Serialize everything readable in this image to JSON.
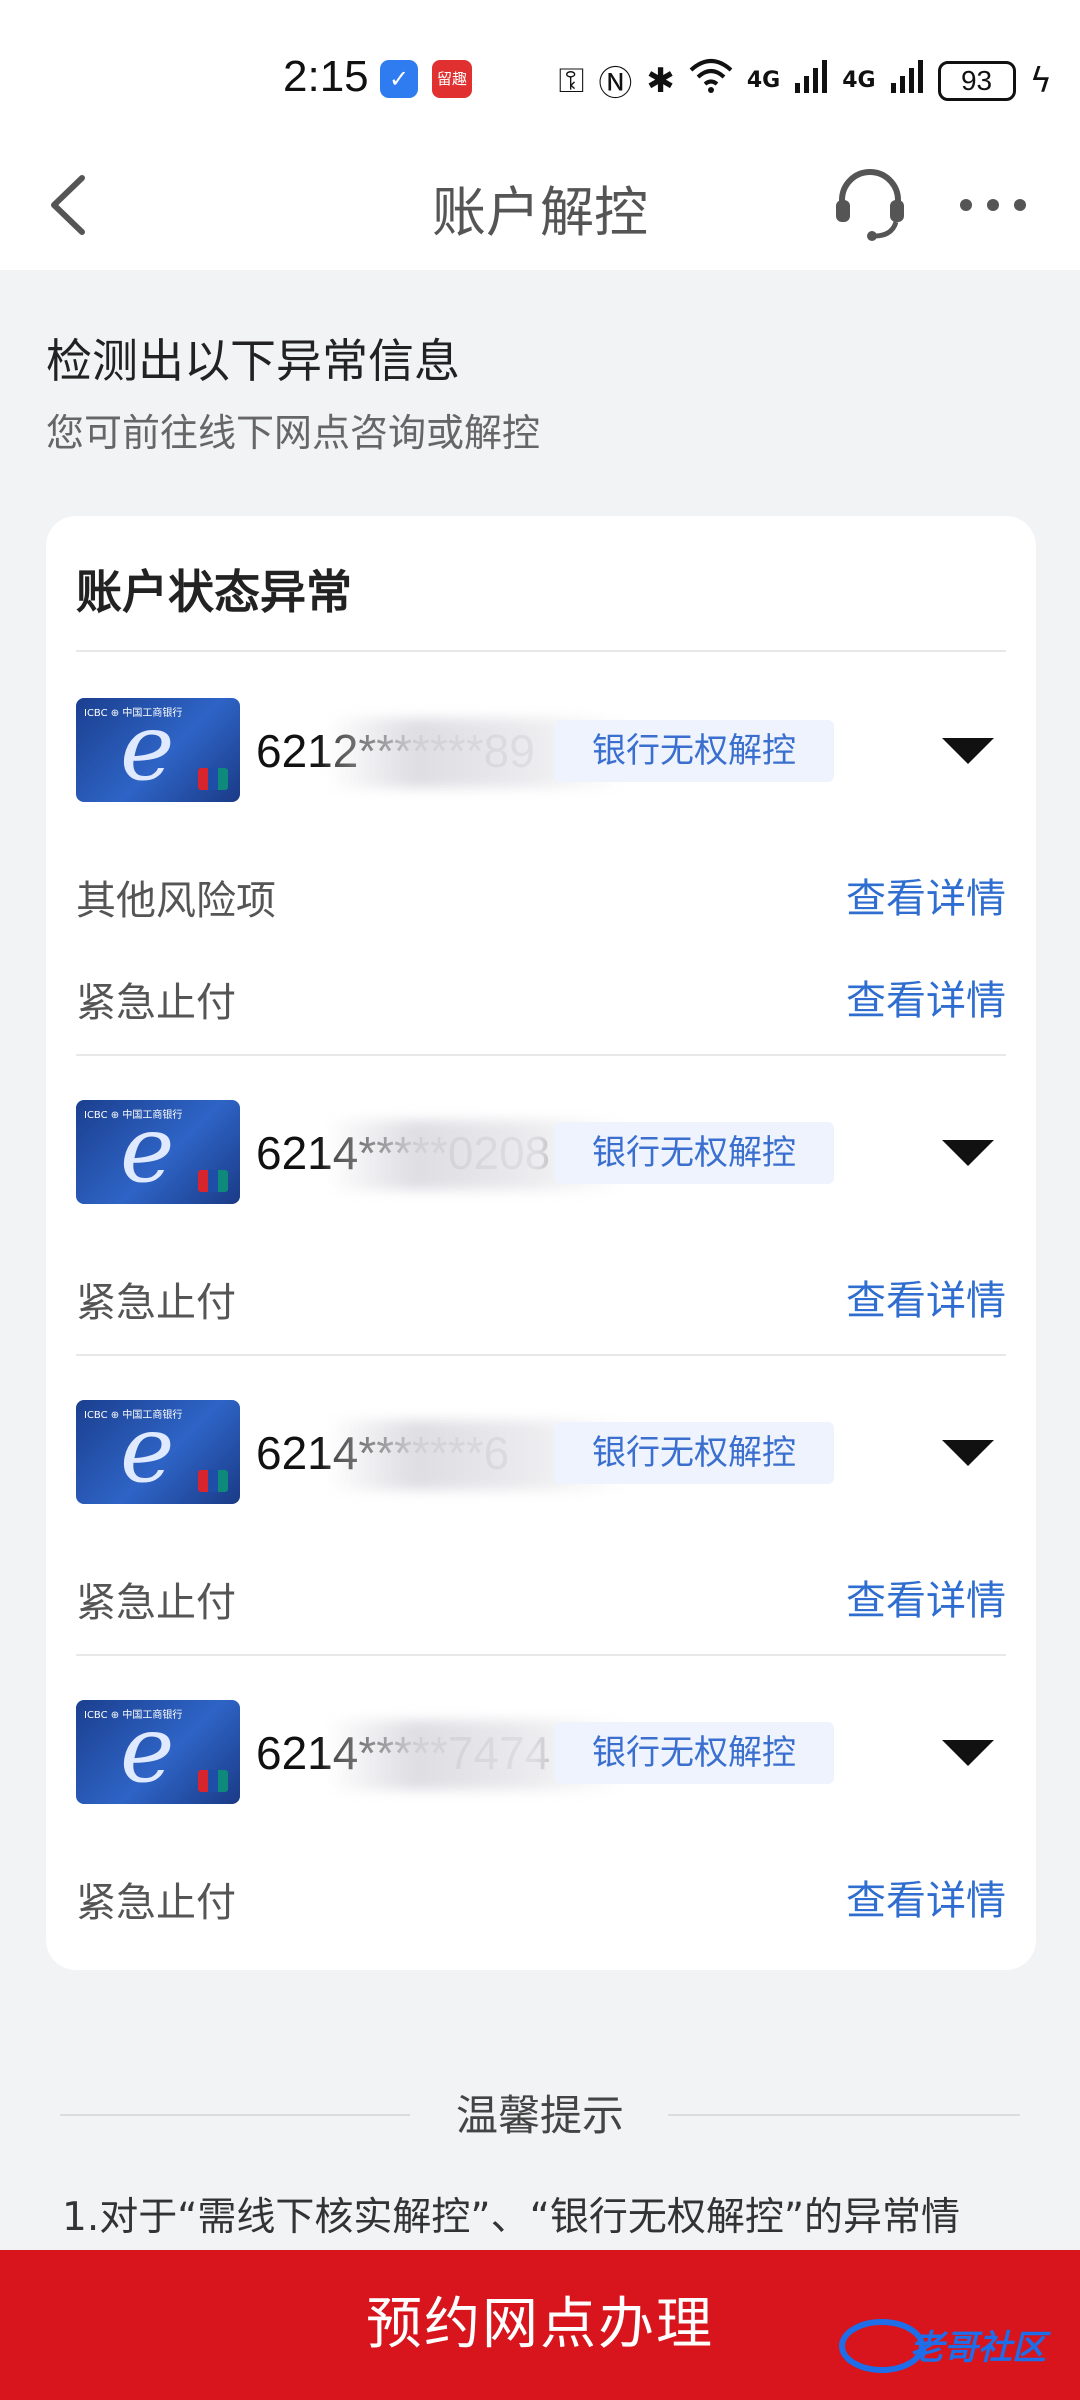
{
  "status_bar": {
    "time": "2:15",
    "app1_glyph": "✓",
    "app2_glyph": "留趣",
    "net1": "4G",
    "net2": "4G",
    "battery": "93"
  },
  "nav": {
    "title": "账户解控"
  },
  "header": {
    "title": "检测出以下异常信息",
    "subtitle": "您可前往线下网点咨询或解控"
  },
  "card": {
    "title": "账户状态异常",
    "accounts": [
      {
        "number": "6212*******89",
        "badge": "银行无权解控",
        "items": [
          {
            "label": "其他风险项",
            "link": "查看详情"
          },
          {
            "label": "紧急止付",
            "link": "查看详情"
          }
        ]
      },
      {
        "number": "6214*****0208",
        "badge": "银行无权解控",
        "items": [
          {
            "label": "紧急止付",
            "link": "查看详情"
          }
        ]
      },
      {
        "number": "6214*******6",
        "badge": "银行无权解控",
        "items": [
          {
            "label": "紧急止付",
            "link": "查看详情"
          }
        ]
      },
      {
        "number": "6214*****7474",
        "badge": "银行无权解控",
        "items": [
          {
            "label": "紧急止付",
            "link": "查看详情"
          }
        ]
      }
    ]
  },
  "tips": {
    "title": "温馨提示",
    "line1": "1.对于“需线下核实解控”、“银行无权解控”的异常情"
  },
  "bottom_button": {
    "label": "预约网点办理"
  },
  "watermark": {
    "text": "老哥社区"
  },
  "colors": {
    "accent": "#2f6ed0",
    "badge_bg": "#eef3fd",
    "button": "#d8141c",
    "page_bg": "#f2f3f5"
  }
}
